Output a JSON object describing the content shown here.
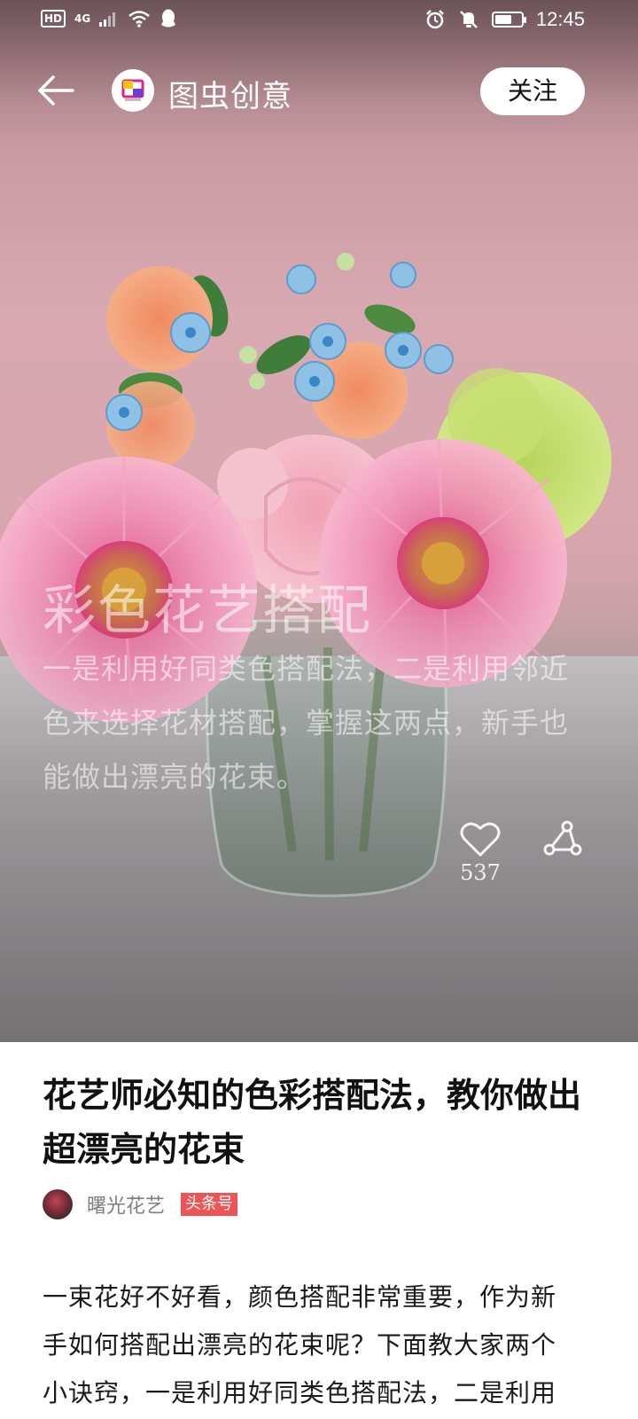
{
  "status_bar": {
    "left_badges": [
      "HD",
      "4G"
    ],
    "icons": [
      "signal-icon",
      "wifi-icon",
      "qq-icon",
      "alarm-icon",
      "mute-icon",
      "battery-icon"
    ],
    "battery_level": 0.7,
    "time": "12:45"
  },
  "nav": {
    "back_icon": "arrow-left-icon",
    "channel_name": "图虫创意",
    "follow_label": "关注"
  },
  "hero": {
    "overlay_title": "彩色花艺搭配",
    "overlay_description": "一是利用好同类色搭配法，二是利用邻近色来选择花材搭配，掌握这两点，新手也能做出漂亮的花束。",
    "like_count": "537",
    "like_icon": "heart-icon",
    "share_icon": "share-icon"
  },
  "article": {
    "title": "花艺师必知的色彩搭配法，教你做出超漂亮的花束",
    "author_name": "曙光花艺",
    "author_tag": "头条号",
    "body": "一束花好不好看，颜色搭配非常重要，作为新手如何搭配出漂亮的花束呢？下面教大家两个小诀窍，一是利用好同类色搭配法，二是利用"
  },
  "colors": {
    "tag_red": "#f05354",
    "title_text": "#111111",
    "meta_gray": "#7f7f7f"
  }
}
